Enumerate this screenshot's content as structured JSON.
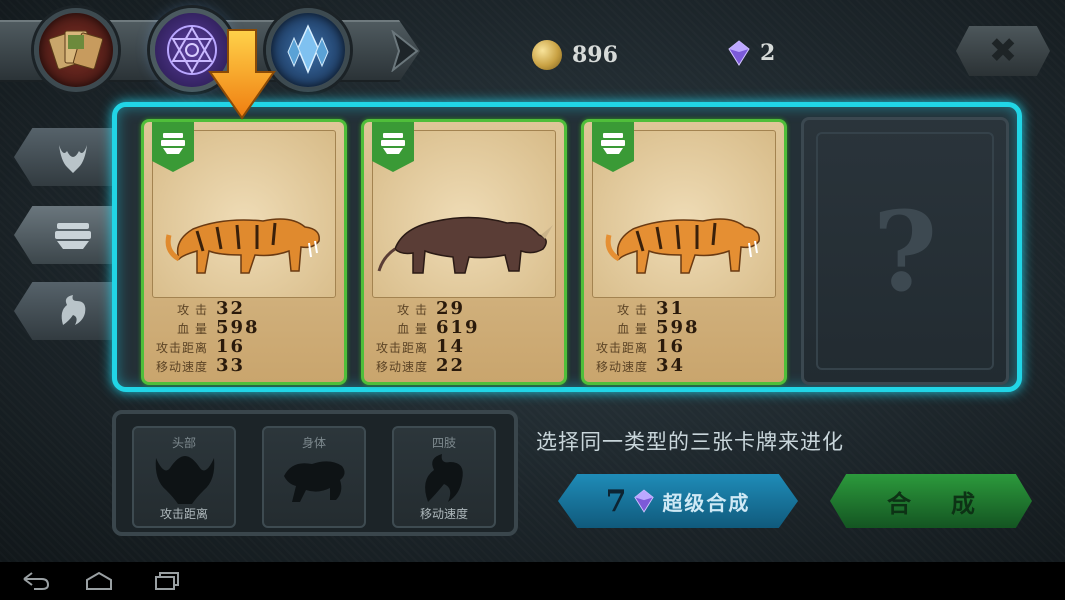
{
  "top": {
    "tabs": [
      {
        "name": "cards",
        "icon": "card-stack-icon"
      },
      {
        "name": "evolve",
        "icon": "hexagram-icon",
        "active": true
      },
      {
        "name": "crystal",
        "icon": "crystal-icon"
      }
    ],
    "coins": "896",
    "gems": "2",
    "close_icon": "close-icon"
  },
  "side_tabs": [
    {
      "name": "head",
      "icon": "head-icon"
    },
    {
      "name": "body",
      "icon": "body-icon",
      "active": true
    },
    {
      "name": "limb",
      "icon": "limb-icon"
    }
  ],
  "stat_labels": {
    "attack": "攻 击",
    "hp": "血 量",
    "range": "攻击距离",
    "speed": "移动速度"
  },
  "cards": [
    {
      "creature": "tiger",
      "attack": "32",
      "hp": "598",
      "range": "16",
      "speed": "33"
    },
    {
      "creature": "rhino",
      "attack": "29",
      "hp": "619",
      "range": "14",
      "speed": "22"
    },
    {
      "creature": "tiger",
      "attack": "31",
      "hp": "598",
      "range": "16",
      "speed": "34"
    }
  ],
  "empty_slot": "?",
  "parts": [
    {
      "top": "头部",
      "bottom": "攻击距离"
    },
    {
      "top": "身体",
      "bottom": ""
    },
    {
      "top": "四肢",
      "bottom": "移动速度"
    }
  ],
  "hint": "选择同一类型的三张卡牌来进化",
  "super_button": {
    "count": "7",
    "label": "超级合成"
  },
  "compose_button": {
    "label": "合成"
  },
  "colors": {
    "panel_glow": "#21d5e6",
    "card_border": "#4fbe3a",
    "super_btn": "#1f8cb8",
    "compose_btn": "#2c9a3c",
    "arrow": "#f5a21a"
  }
}
